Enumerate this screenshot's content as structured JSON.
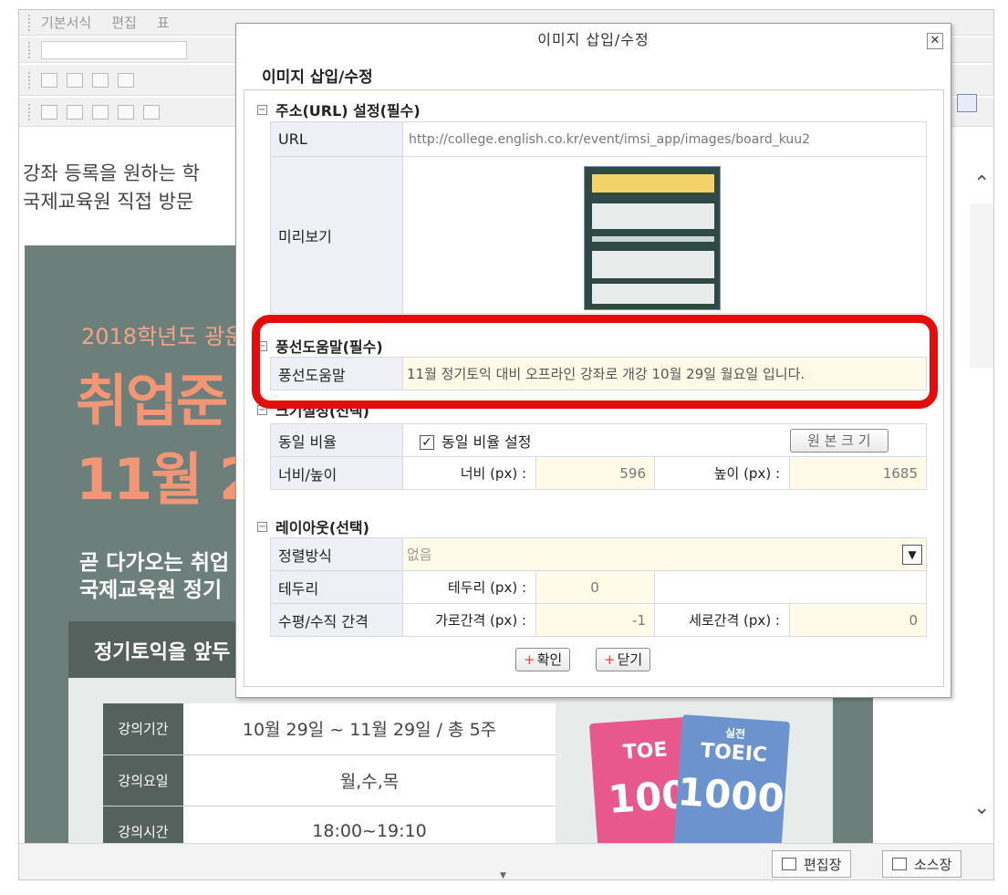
{
  "editor": {
    "menu": [
      "기본서식",
      "편집",
      "표"
    ],
    "body_lines": [
      "강좌 등록을 원하는 학",
      "국제교육원 직접 방문"
    ],
    "mode_buttons": {
      "edit": "편집장",
      "source": "소스장"
    }
  },
  "banner": {
    "year_line": "2018학년도 광운",
    "big_line1": "취업준",
    "big_line2": "11월 2",
    "sub_line1": "곧 다가오는 취업",
    "sub_line2": "국제교육원 정기",
    "box_heading": "정기토익을 앞두",
    "table": [
      {
        "key": "강의기간",
        "value": "10월 29일 ~ 11월 29일 / 총 5주"
      },
      {
        "key": "강의요일",
        "value": "월,수,목"
      },
      {
        "key": "강의시간",
        "value": "18:00~19:10"
      }
    ],
    "books": [
      {
        "title": "TOEIC",
        "number": "1000",
        "prefix": "실전"
      },
      {
        "title": "TOE",
        "number": "100",
        "prefix": "실전"
      }
    ],
    "colors": {
      "bg": "#6c7f7b",
      "accent": "#f39676"
    }
  },
  "dialog": {
    "title": "이미지 삽입/수정",
    "close": "✕",
    "heading": "이미지 삽입/수정",
    "url_section": {
      "title": "주소(URL) 설정(필수)",
      "url_label": "URL",
      "url_value": "http://college.english.co.kr/event/imsi_app/images/board_kuu2",
      "preview_label": "미리보기"
    },
    "tooltip_section": {
      "title": "풍선도움말(필수)",
      "label": "풍선도움말",
      "value": "11월 정기토익 대비 오프라인 강좌로 개강 10월 29일 월요일 입니다."
    },
    "size_section": {
      "title": "크기설정(선택)",
      "ratio_label": "동일 비율",
      "ratio_checkbox": "동일 비율 설정",
      "original_button": "원 본 크 기",
      "wh_label": "너비/높이",
      "width_label": "너비 (px) :",
      "width_value": "596",
      "height_label": "높이 (px) :",
      "height_value": "1685"
    },
    "layout_section": {
      "title": "레이아웃(선택)",
      "align_label": "정렬방식",
      "align_value": "없음",
      "border_label": "테두리",
      "border_px_label": "테두리 (px) :",
      "border_value": "0",
      "spacing_label": "수평/수직 간격",
      "hspace_label": "가로간격 (px) :",
      "hspace_value": "-1",
      "vspace_label": "세로간격 (px) :",
      "vspace_value": "0"
    },
    "ok_button": "확인",
    "close_button": "닫기",
    "highlight_color": "#e30d0d"
  }
}
